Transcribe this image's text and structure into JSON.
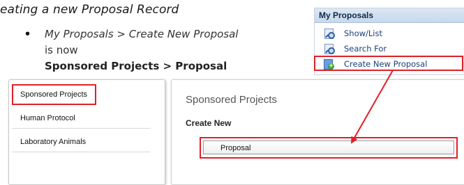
{
  "slide": {
    "heading": "eating a new Proposal Record",
    "bullet_symbol": "•",
    "line1": "My Proposals > Create New Proposal",
    "line2": "is now",
    "line3": "Sponsored Projects > Proposal"
  },
  "my_proposals_panel": {
    "header": "My Proposals",
    "items": [
      {
        "label": "Show/List",
        "icon": "document-search-icon"
      },
      {
        "label": "Search For",
        "icon": "document-search-icon"
      },
      {
        "label": "Create New Proposal",
        "icon": "create-new-icon"
      }
    ],
    "plus_glyph": "+"
  },
  "sponsored_projects_menu": {
    "items": [
      "Sponsored Projects",
      "Human Protocol",
      "Laboratory Animals"
    ]
  },
  "content_panel": {
    "title": "Sponsored Projects",
    "subtitle": "Create New",
    "button_label": "Proposal"
  },
  "colors": {
    "highlight_red": "#e21f26",
    "link_blue": "#1c3f7a",
    "panel_header_bg": "#c7d9ec"
  }
}
